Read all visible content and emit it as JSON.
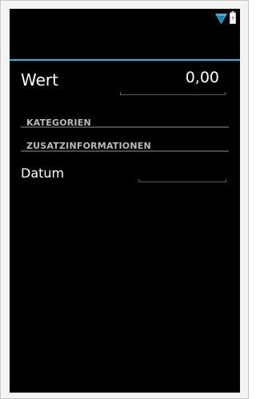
{
  "status_bar": {
    "icons": [
      "wifi-icon",
      "battery-icon"
    ],
    "accent_color": "#33b5e5"
  },
  "form": {
    "wert_label": "Wert",
    "wert_value": "0,00",
    "section_categories": "KATEGORIEN",
    "section_additional_info": "ZUSATZINFORMATIONEN",
    "datum_label": "Datum",
    "datum_value": ""
  },
  "colors": {
    "background": "#000000",
    "accent": "#33b5e5",
    "text_primary": "#ffffff",
    "text_section": "#bbbbbb"
  }
}
